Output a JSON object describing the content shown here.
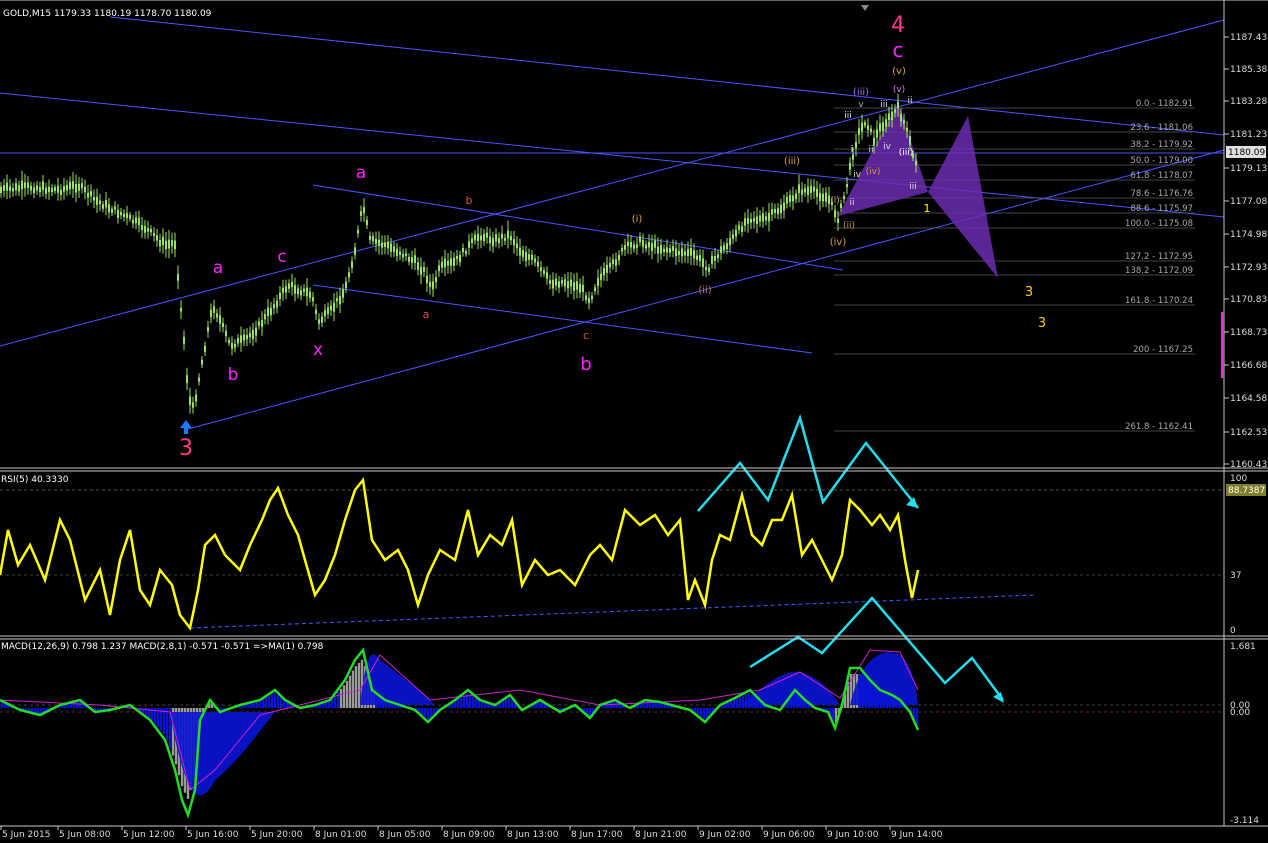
{
  "colors": {
    "background": "#000000",
    "frame": "#c8c8c8",
    "candles": "#9be55a",
    "trendlines": "#4a55ff",
    "rsi": "#ffff00",
    "macd_signal": "#22dd22",
    "macd_hist_blue": "#0a14d8",
    "macd_hist_gray": "#9a9a9a",
    "macd_ma": "#cc22cc",
    "arrows": "#22ddee",
    "wave_magenta": "#ff22ff",
    "wave_pink": "#ff3a8c",
    "harmonic": "#6c2bb0",
    "price_label_bg": "#e0e0e0",
    "rsi_value_bg": "#7f7f2a"
  },
  "main": {
    "header": "GOLD,M15  1179.33 1180.19 1178.70 1180.09",
    "current_price": "1180.09",
    "axis_labels": [
      "1187.43",
      "1185.38",
      "1183.28",
      "1181.23",
      "1179.13",
      "1177.08",
      "1174.98",
      "1172.93",
      "1170.83",
      "1168.73",
      "1166.68",
      "1164.58",
      "1162.53",
      "1160.43"
    ],
    "fib_levels": [
      "0.0 - 1182.91",
      "23.6 - 1181.06",
      "38.2 - 1179.92",
      "50.0 - 1179.00",
      "61.8 - 1178.07",
      "78.6 - 1176.76",
      "88.6 - 1175.97",
      "100.0 - 1175.08",
      "127.2 - 1172.95",
      "138.2 - 1172.09",
      "161.8 - 1170.24",
      "200 - 1167.25",
      "261.8 - 1162.41"
    ],
    "wave_labels": [
      {
        "t": "4"
      },
      {
        "t": "c"
      },
      {
        "t": "(v)"
      },
      {
        "t": "(iii)"
      },
      {
        "t": "v"
      },
      {
        "t": "iii"
      },
      {
        "t": "ii"
      },
      {
        "t": "(v)"
      },
      {
        "t": "iii"
      },
      {
        "t": "i"
      },
      {
        "t": "ii"
      },
      {
        "t": "iv"
      },
      {
        "t": "iv"
      },
      {
        "t": "(iv)"
      },
      {
        "t": "iii"
      },
      {
        "t": "(i)"
      },
      {
        "t": "ii"
      },
      {
        "t": "(ii)"
      },
      {
        "t": "(iv)"
      },
      {
        "t": "(iii)"
      },
      {
        "t": "1"
      },
      {
        "t": "(iii)"
      },
      {
        "t": "(i)"
      },
      {
        "t": "(ii)"
      },
      {
        "t": "3"
      },
      {
        "t": "3"
      },
      {
        "t": "a"
      },
      {
        "t": "c"
      },
      {
        "t": "b"
      },
      {
        "t": "x"
      },
      {
        "t": "a"
      },
      {
        "t": "b"
      },
      {
        "t": "a"
      },
      {
        "t": "c"
      },
      {
        "t": "b"
      },
      {
        "t": "3"
      }
    ]
  },
  "rsi": {
    "header": "RSI(5) 40.3330",
    "value_label": "88.7387",
    "axis_labels": [
      "100",
      "37",
      "0"
    ]
  },
  "macd": {
    "header": "MACD(12,26,9) 0.798 1.237  MACD(2,8,1) -0.571 -0.571  =>MA(1) 0.798",
    "axis_labels": [
      "1.681",
      "0.00",
      "0.00",
      "-3.114"
    ]
  },
  "time_axis": [
    "5 Jun 2015",
    "5 Jun 08:00",
    "5 Jun 12:00",
    "5 Jun 16:00",
    "5 Jun 20:00",
    "8 Jun 01:00",
    "8 Jun 05:00",
    "8 Jun 09:00",
    "8 Jun 13:00",
    "8 Jun 17:00",
    "8 Jun 21:00",
    "9 Jun 02:00",
    "9 Jun 06:00",
    "9 Jun 10:00",
    "9 Jun 14:00"
  ]
}
